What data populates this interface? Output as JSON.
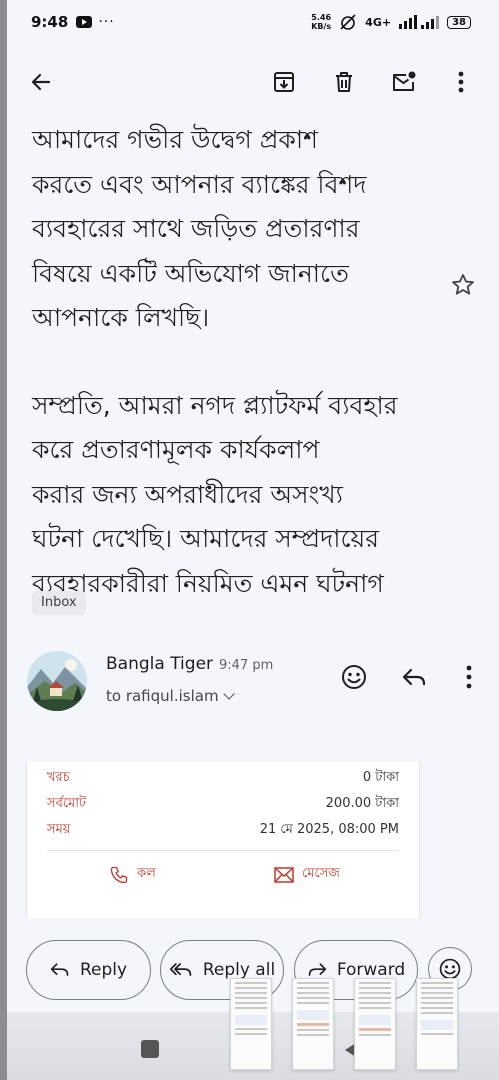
{
  "status_bar": {
    "time": "9:48",
    "dots": "···",
    "net_speed_value": "5.46",
    "net_speed_unit": "KB/s",
    "signal_label": "4G+",
    "battery": "38"
  },
  "toolbar": {
    "back_icon": "arrow-left-icon",
    "archive_icon": "archive-icon",
    "delete_icon": "trash-icon",
    "unread_icon": "mark-unread-icon",
    "more_icon": "more-vert-icon"
  },
  "message": {
    "paragraphs": [
      "আমাদের গভীর উদ্বেগ প্রকাশ\nকরতে এবং আপনার ব্যাঙ্কের বিশদ\nব্যবহারের সাথে জড়িত প্রতারণার\nবিষয়ে একটি অভিযোগ জানাতে\nআপনাকে লিখছি।",
      "সম্প্রতি, আমরা নগদ প্ল্যাটফর্ম ব্যবহার\nকরে প্রতারণামূলক কার্যকলাপ\nকরার জন্য অপরাধীদের অসংখ্য\nঘটনা দেখেছি। আমাদের সম্প্রদায়ের\nব্যবহারকারীরা নিয়মিত এমন ঘটনাগ"
    ],
    "label_chip": "Inbox"
  },
  "sender": {
    "name": "Bangla Tiger",
    "time": "9:47 pm",
    "recipient": "to rafiqul.islam"
  },
  "card": {
    "rows": [
      {
        "label": "খরচ",
        "value": "0 টাকা"
      },
      {
        "label": "সর্বমোট",
        "value": "200.00 টাকা"
      },
      {
        "label": "সময়",
        "value": "21 মে 2025, 08:00 PM"
      }
    ],
    "call_label": "কল",
    "message_label": "মেসেজ",
    "accent_color": "#c0392b"
  },
  "actions": {
    "reply": "Reply",
    "reply_all": "Reply all",
    "forward": "Forward"
  }
}
